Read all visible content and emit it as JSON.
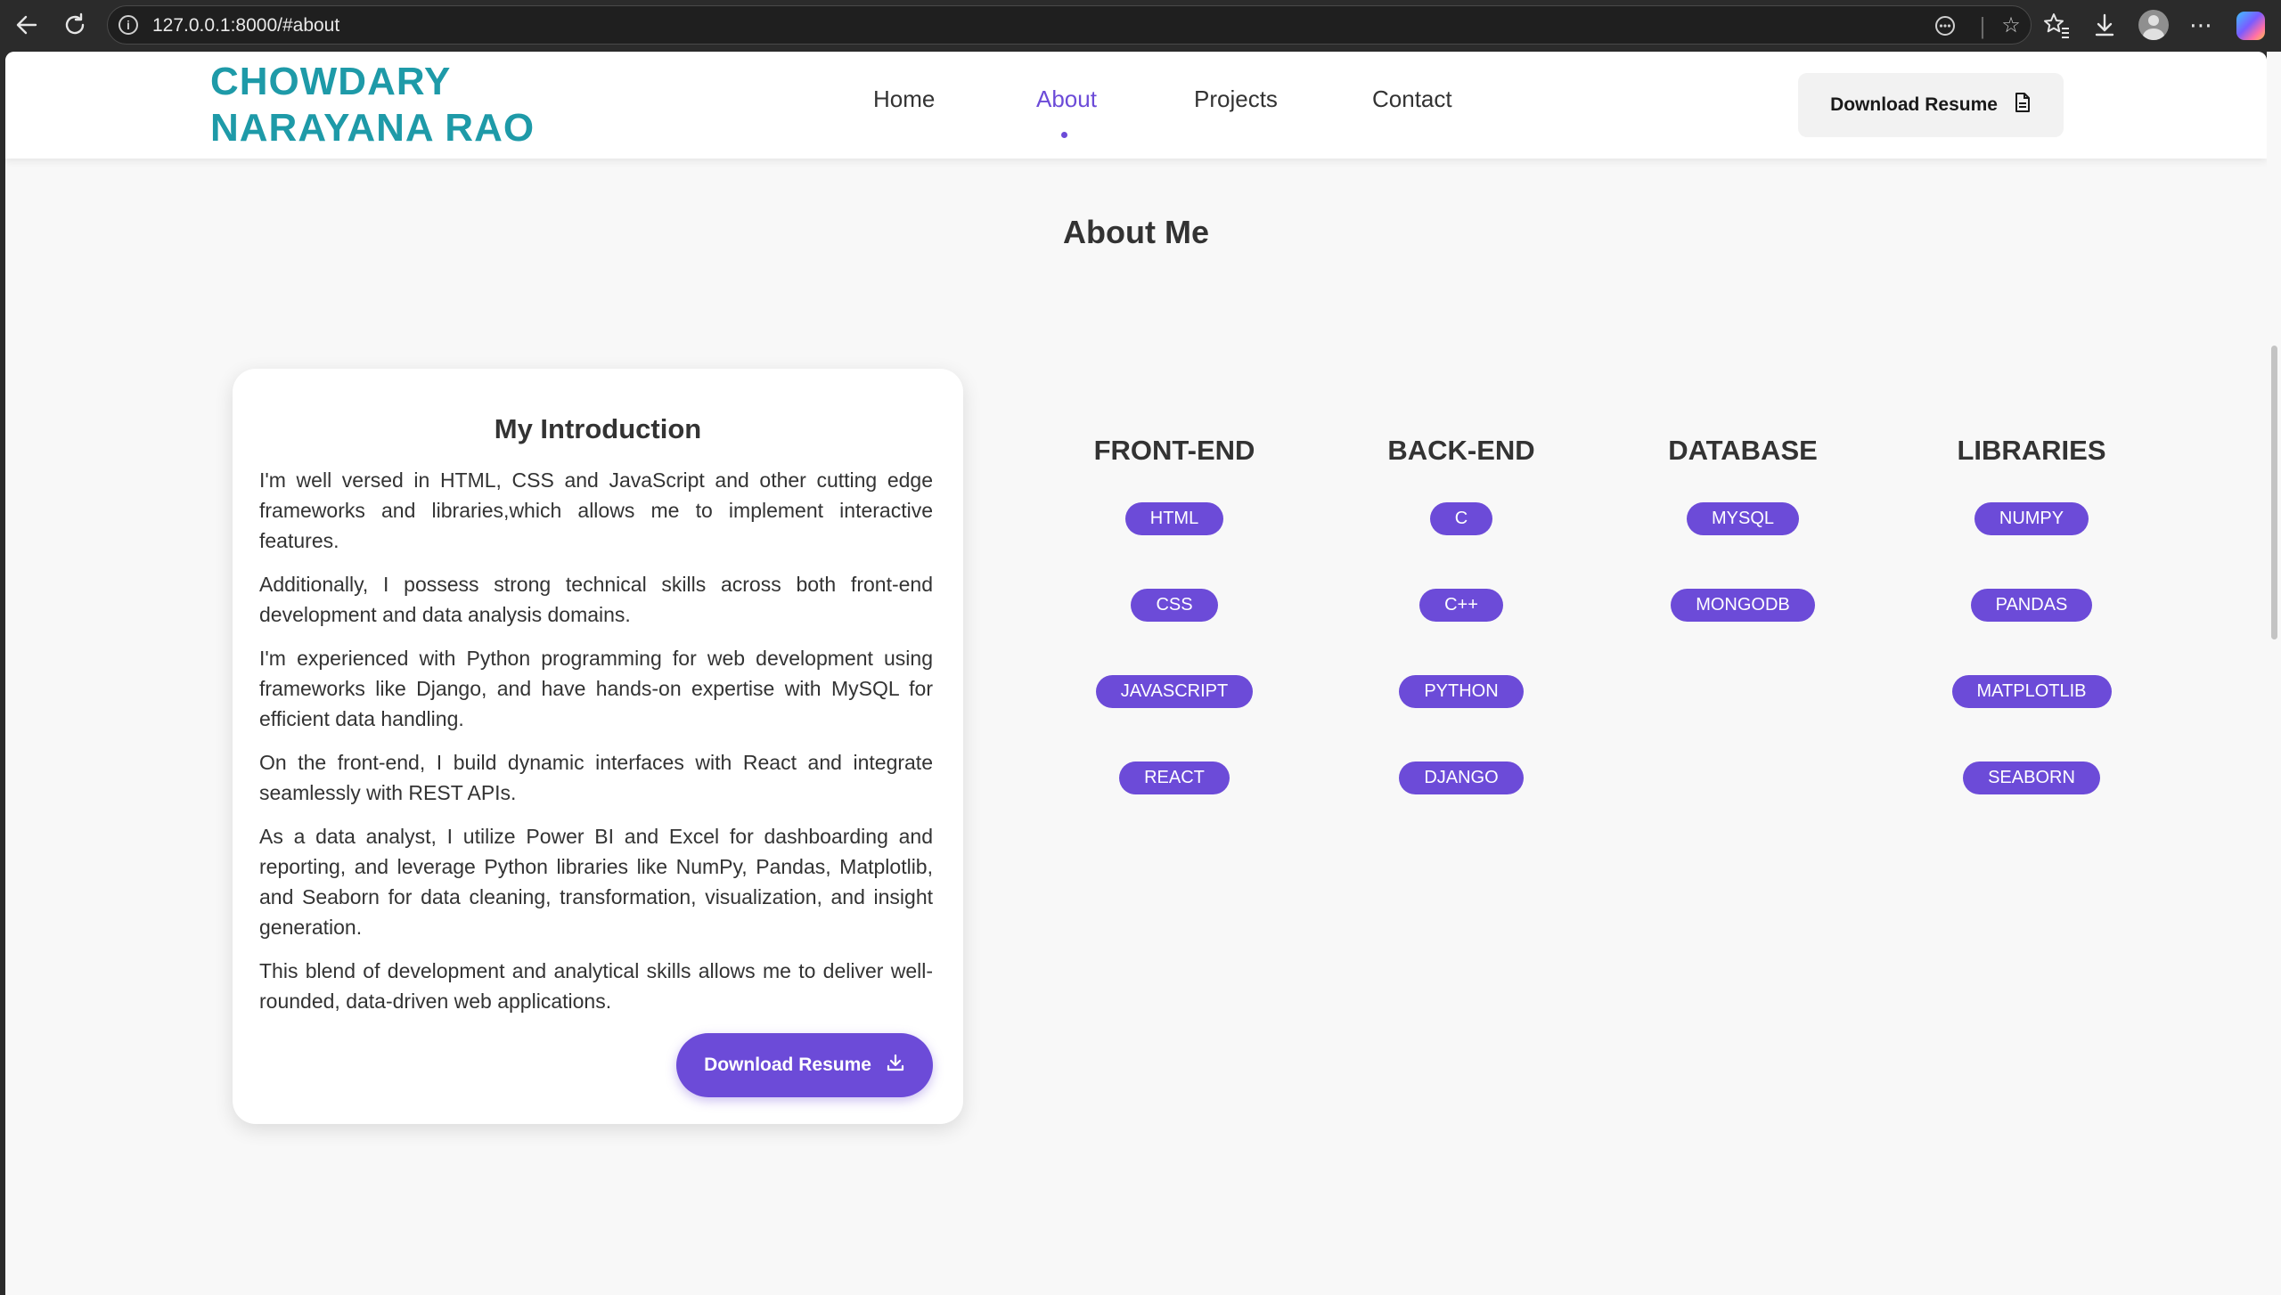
{
  "browser": {
    "url": "127.0.0.1:8000/#about"
  },
  "header": {
    "brand_line1": "CHOWDARY",
    "brand_line2": "NARAYANA RAO",
    "nav": [
      {
        "label": "Home",
        "active": false
      },
      {
        "label": "About",
        "active": true
      },
      {
        "label": "Projects",
        "active": false
      },
      {
        "label": "Contact",
        "active": false
      }
    ],
    "resume_button": "Download Resume"
  },
  "about": {
    "title": "About Me",
    "intro": {
      "title": "My Introduction",
      "paragraphs": [
        "I'm well versed in HTML, CSS and JavaScript and other cutting edge frameworks and libraries,which allows me to implement interactive features.",
        "Additionally, I possess strong technical skills across both front-end development and data analysis domains.",
        "I'm experienced with Python programming for web development using frameworks like Django, and have hands-on expertise with MySQL for efficient data handling.",
        "On the front-end, I build dynamic interfaces with React and integrate seamlessly with REST APIs.",
        "As a data analyst, I utilize Power BI and Excel for dashboarding and reporting, and leverage Python libraries like NumPy, Pandas, Matplotlib, and Seaborn for data cleaning, transformation, visualization, and insight generation.",
        "This blend of development and analytical skills allows me to deliver well-rounded, data-driven web applications."
      ],
      "button": "Download Resume"
    },
    "skills": [
      {
        "heading": "FRONT-END",
        "items": [
          "HTML",
          "CSS",
          "JAVASCRIPT",
          "REACT"
        ]
      },
      {
        "heading": "BACK-END",
        "items": [
          "C",
          "C++",
          "PYTHON",
          "DJANGO"
        ]
      },
      {
        "heading": "DATABASE",
        "items": [
          "MYSQL",
          "MONGODB"
        ]
      },
      {
        "heading": "LIBRARIES",
        "items": [
          "NUMPY",
          "PANDAS",
          "MATPLOTLIB",
          "SEABORN"
        ]
      }
    ]
  },
  "colors": {
    "accent": "#6c4bd8",
    "brand": "#1e9aa8",
    "page_bg": "#f8f8f8"
  },
  "icons": {
    "back": "back-arrow-icon",
    "reload": "reload-icon",
    "site_info": "info-icon",
    "reader": "reader-mode-icon",
    "favorite": "star-icon",
    "favorites": "favorites-icon",
    "downloads": "download-icon",
    "profile": "profile-icon",
    "menu": "more-icon",
    "copilot": "copilot-icon",
    "resume_doc": "document-icon",
    "resume_download": "download-icon"
  }
}
